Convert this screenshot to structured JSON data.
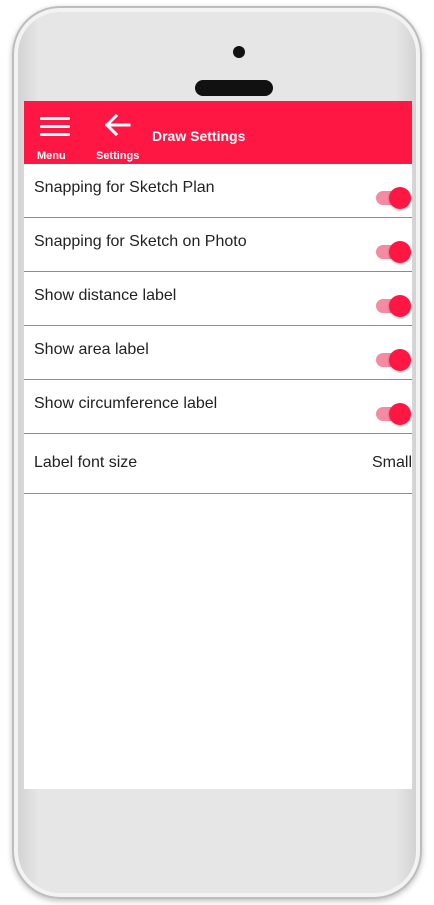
{
  "app_bar": {
    "title": "Draw Settings",
    "menu_label": "Menu",
    "back_label": "Settings",
    "color": "#ff1744",
    "menu_icon": "hamburger-icon",
    "back_icon": "arrow-left-icon"
  },
  "settings": {
    "items": [
      {
        "label": "Snapping for Sketch Plan",
        "type": "toggle",
        "checked": true
      },
      {
        "label": "Snapping for Sketch on Photo",
        "type": "toggle",
        "checked": true
      },
      {
        "label": "Show distance label",
        "type": "toggle",
        "checked": true
      },
      {
        "label": "Show area label",
        "type": "toggle",
        "checked": true
      },
      {
        "label": "Show circumference label",
        "type": "toggle",
        "checked": true
      },
      {
        "label": "Label font size",
        "type": "value",
        "value": "Small"
      }
    ]
  }
}
